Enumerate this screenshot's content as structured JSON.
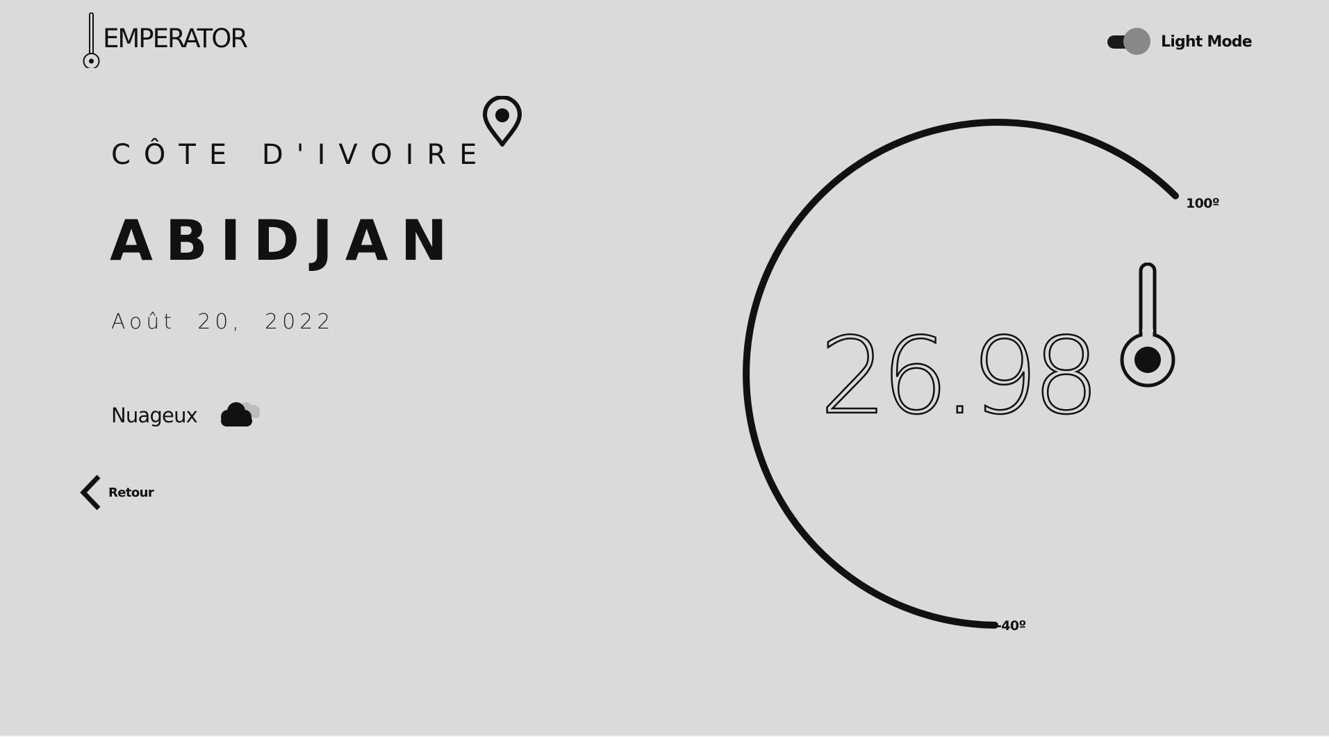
{
  "header": {
    "logo_text": "EMPERATOR",
    "mode_label": "Light Mode"
  },
  "location": {
    "country": "CÔTE D'IVOIRE",
    "city": "ABIDJAN",
    "date": "Août  20,  2022"
  },
  "weather": {
    "condition": "Nuageux",
    "icon": "cloud-icon"
  },
  "nav": {
    "back_label": "Retour"
  },
  "gauge": {
    "temperature": "26.98",
    "max_label": "100º",
    "min_label": "-40º"
  },
  "colors": {
    "background": "#dadada",
    "ink": "#111111",
    "toggle_knob": "#888888"
  }
}
